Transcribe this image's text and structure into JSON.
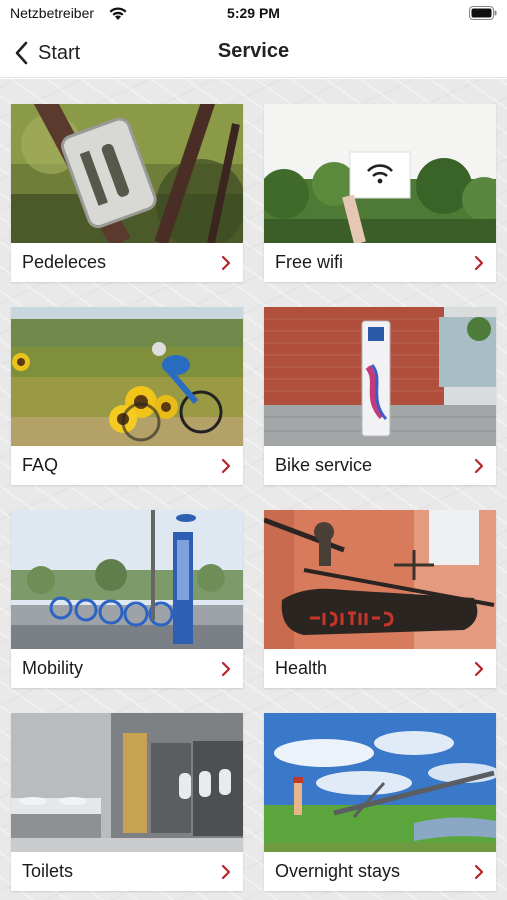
{
  "status_bar": {
    "carrier": "Netzbetreiber",
    "time": "5:29 PM",
    "icons": [
      "wifi-icon",
      "battery-icon"
    ]
  },
  "nav": {
    "back_label": "Start",
    "title": "Service"
  },
  "accent_color": "#b3262b",
  "tiles": [
    {
      "label": "Pedeleces",
      "image": "bike-closeup-photo"
    },
    {
      "label": "Free wifi",
      "image": "wifi-sign-photo"
    },
    {
      "label": "FAQ",
      "image": "cyclist-sunflowers-photo"
    },
    {
      "label": "Bike service",
      "image": "bike-repair-station-photo"
    },
    {
      "label": "Mobility",
      "image": "bike-rental-station-photo"
    },
    {
      "label": "Health",
      "image": "pharmacy-sign-photo"
    },
    {
      "label": "Toilets",
      "image": "restroom-photo"
    },
    {
      "label": "Overnight stays",
      "image": "riverside-landscape-photo"
    }
  ]
}
